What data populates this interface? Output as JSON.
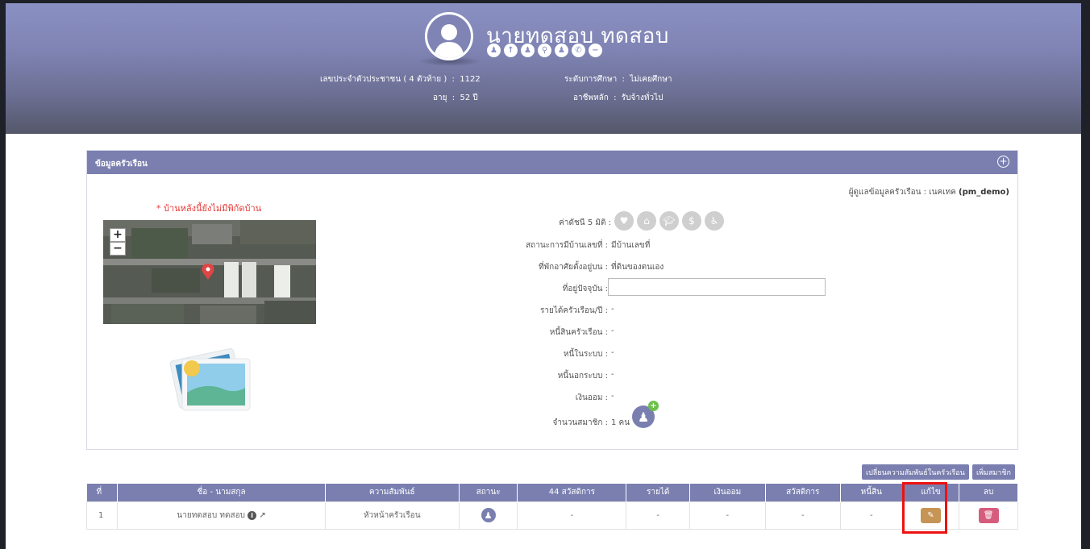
{
  "header": {
    "person_name": "นายทดสอบ ทดสอบ",
    "status_icons": [
      "person-icon",
      "person-up-icon",
      "person-walk-icon",
      "person-stand-icon",
      "person-icon",
      "phone-icon",
      "minus-icon"
    ],
    "fields": [
      {
        "label": "เลขประจำตัวประชาชน ( 4 ตัวท้าย )",
        "value": "1122"
      },
      {
        "label": "อายุ",
        "value": "52 ปี"
      },
      {
        "label": "ระดับการศึกษา",
        "value": "ไม่เคยศึกษา"
      },
      {
        "label": "อาชีพหลัก",
        "value": "รับจ้างทั่วไป"
      }
    ]
  },
  "household": {
    "title": "ข้อมูลครัวเรือน",
    "caretaker_label": "ผู้ดูแลข้อมูลครัวเรือน : เนคเทค",
    "caretaker_user": "(pm_demo)",
    "no_coords": "* บ้านหลังนี้ยังไม่มีพิกัดบ้าน",
    "map_zoom_in": "+",
    "map_zoom_out": "−",
    "fields": {
      "index_label": "ค่าดัชนี 5 มิติ :",
      "house_no_label": "สถานะการมีบ้านเลขที่ :",
      "house_no_value": "มีบ้านเลขที่",
      "residence_label": "ที่พักอาศัยตั้งอยู่บน :",
      "residence_value": "ที่ดินของตนเอง",
      "address_label": "ที่อยู่ปัจจุบัน :",
      "address_value": "",
      "income_label": "รายได้ครัวเรือน/ปี :",
      "income_value": "-",
      "debt_label": "หนี้สินครัวเรือน :",
      "debt_value": "-",
      "debt_in_label": "หนี้ในระบบ :",
      "debt_in_value": "-",
      "debt_out_label": "หนี้นอกระบบ :",
      "debt_out_value": "-",
      "savings_label": "เงินออม :",
      "savings_value": "-",
      "members_label": "จำนวนสมาชิก :",
      "members_value": "1 คน"
    }
  },
  "actions": {
    "change_relation": "เปลี่ยนความสัมพันธ์ในครัวเรือน",
    "add_member": "เพิ่มสมาชิก"
  },
  "table": {
    "headers": [
      "ที่",
      "ชื่อ - นามสกุล",
      "ความสัมพันธ์",
      "สถานะ",
      "44 สวัสดิการ",
      "รายได้",
      "เงินออม",
      "สวัสดิการ",
      "หนี้สิน",
      "แก้ไข",
      "ลบ"
    ],
    "rows": [
      {
        "no": "1",
        "name": "นายทดสอบ ทดสอบ",
        "relation": "หัวหน้าครัวเรือน",
        "welfare44": "-",
        "income": "-",
        "savings": "-",
        "welfare": "-",
        "debt": "-"
      }
    ]
  }
}
